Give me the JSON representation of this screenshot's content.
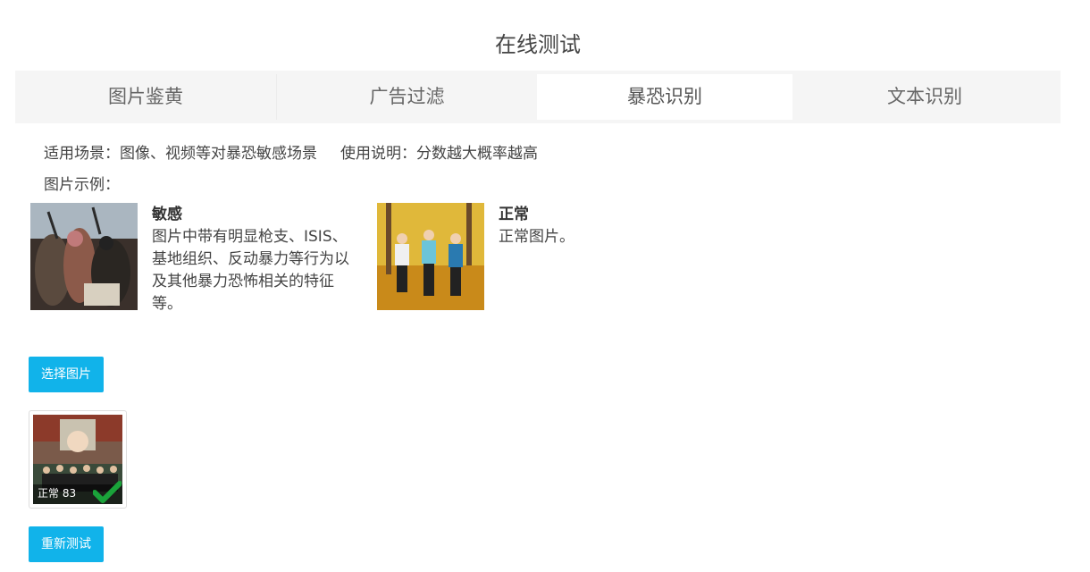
{
  "page_title": "在线测试",
  "tabs": [
    {
      "label": "图片鉴黄"
    },
    {
      "label": "广告过滤"
    },
    {
      "label": "暴恐识别"
    },
    {
      "label": "文本识别"
    }
  ],
  "active_tab": "暴恐识别",
  "info": {
    "scenario": "适用场景：图像、视频等对暴恐敏感场景",
    "instructions": "使用说明：分数越大概率越高",
    "examples_label": "图片示例："
  },
  "examples": [
    {
      "title": "敏感",
      "description": "图片中带有明显枪支、ISIS、基地组织、反动暴力等行为以及其他暴力恐怖相关的特征等。"
    },
    {
      "title": "正常",
      "description": "正常图片。"
    }
  ],
  "buttons": {
    "select_image": "选择图片",
    "retest": "重新测试"
  },
  "result": {
    "label": "正常 83",
    "status_color": "#1aa33a"
  },
  "colors": {
    "accent": "#11b3ea",
    "tab_bg": "#f5f5f5",
    "active_tab_bg": "#ffffff"
  }
}
